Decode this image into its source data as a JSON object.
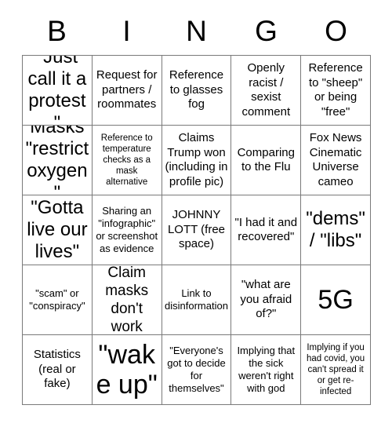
{
  "card": {
    "title_letters": [
      "B",
      "I",
      "N",
      "G",
      "O"
    ],
    "free_space_index": {
      "row": 2,
      "col": 2
    },
    "rows": [
      [
        {
          "text": "\"Just call it a protest\"",
          "size": "fs-xl"
        },
        {
          "text": "Request for partners / roommates",
          "size": "fs-md"
        },
        {
          "text": "Reference to glasses fog",
          "size": "fs-md"
        },
        {
          "text": "Openly racist / sexist comment",
          "size": "fs-md"
        },
        {
          "text": "Reference to \"sheep\" or being \"free\"",
          "size": "fs-md"
        }
      ],
      [
        {
          "text": "Masks \"restrict oxygen\"",
          "size": "fs-xl"
        },
        {
          "text": "Reference to temperature checks as a mask alternative",
          "size": "fs-xs"
        },
        {
          "text": "Claims Trump won (including in profile pic)",
          "size": "fs-md"
        },
        {
          "text": "Comparing to the Flu",
          "size": "fs-md"
        },
        {
          "text": "Fox News Cinematic Universe cameo",
          "size": "fs-md"
        }
      ],
      [
        {
          "text": "\"Gotta live our lives\"",
          "size": "fs-xl"
        },
        {
          "text": "Sharing an \"infographic\" or screenshot as evidence",
          "size": "fs-sm"
        },
        {
          "text": "JOHNNY LOTT (free space)",
          "size": "fs-md"
        },
        {
          "text": "\"I had it and recovered\"",
          "size": "fs-md"
        },
        {
          "text": "\"dems\" / \"libs\"",
          "size": "fs-xl"
        }
      ],
      [
        {
          "text": "\"scam\" or \"conspiracy\"",
          "size": "fs-sm"
        },
        {
          "text": "Claim masks don't work",
          "size": "fs-lg"
        },
        {
          "text": "Link to disinformation",
          "size": "fs-sm"
        },
        {
          "text": "\"what are you afraid of?\"",
          "size": "fs-md"
        },
        {
          "text": "5G",
          "size": "fs-xxl"
        }
      ],
      [
        {
          "text": "Statistics (real or fake)",
          "size": "fs-md"
        },
        {
          "text": "\"wake up\"",
          "size": "fs-xxl"
        },
        {
          "text": "\"Everyone's got to decide for themselves\"",
          "size": "fs-sm"
        },
        {
          "text": "Implying that the sick weren't right with god",
          "size": "fs-sm"
        },
        {
          "text": "Implying if you had covid, you can't spread it or get re-infected",
          "size": "fs-xs"
        }
      ]
    ]
  }
}
